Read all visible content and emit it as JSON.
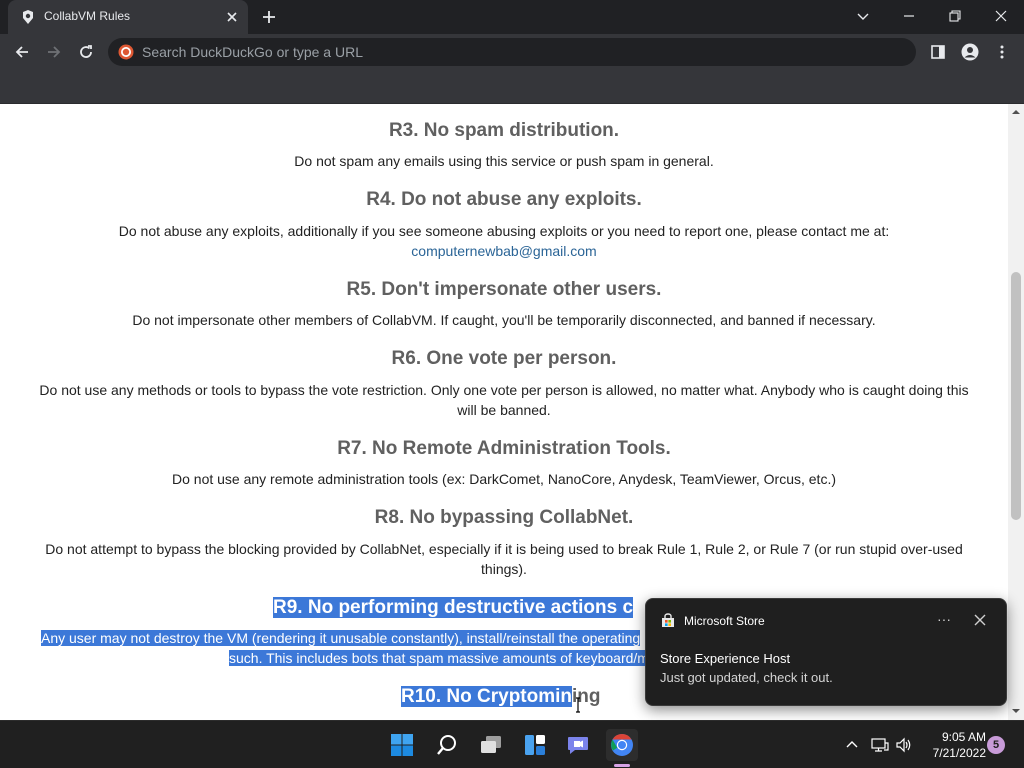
{
  "browser": {
    "tab_title": "CollabVM Rules",
    "omnibox_placeholder": "Search DuckDuckGo or type a URL"
  },
  "page": {
    "rules": [
      {
        "id": "r3",
        "title": "R3. No spam distribution.",
        "text": "Do not spam any emails using this service or push spam in general."
      },
      {
        "id": "r4",
        "title": "R4. Do not abuse any exploits.",
        "text": "Do not abuse any exploits, additionally if you see someone abusing exploits or you need to report one, please contact me at:",
        "email": "computernewbab@gmail.com"
      },
      {
        "id": "r5",
        "title": "R5. Don't impersonate other users.",
        "text": "Do not impersonate other members of CollabVM. If caught, you'll be temporarily disconnected, and banned if necessary."
      },
      {
        "id": "r6",
        "title": "R6. One vote per person.",
        "text_line1": "Do not use any methods or tools to bypass the vote restriction. Only one vote per person is allowed, no matter what. Anybody who is caught doing this",
        "text_line2": "will be banned."
      },
      {
        "id": "r7",
        "title": "R7. No Remote Administration Tools.",
        "text": "Do not use any remote administration tools (ex: DarkComet, NanoCore, Anydesk, TeamViewer, Orcus, etc.)"
      },
      {
        "id": "r8",
        "title": "R8. No bypassing CollabNet.",
        "text_line1": "Do not attempt to bypass the blocking provided by CollabNet, especially if it is being used to break Rule 1, Rule 2, or Rule 7 (or run stupid over-used",
        "text_line2": "things)."
      },
      {
        "id": "r9",
        "title": "R9. No performing destructive actions c",
        "text_line1": "Any user may not destroy the VM (rendering it unusable constantly), install/reinstall the operating",
        "text_line2": "such. This includes bots that spam massive amounts of keyboard/m"
      },
      {
        "id": "r10",
        "title_highlighted": "R10. No Cryptomin",
        "title_rest": "ing"
      }
    ]
  },
  "toast": {
    "app_name": "Microsoft Store",
    "more_label": "···",
    "title": "Store Experience Host",
    "body": "Just got updated, check it out."
  },
  "taskbar": {
    "time": "9:05 AM",
    "date": "7/21/2022",
    "notification_count": "5",
    "apps": [
      "start-icon",
      "search-icon",
      "task-view-icon",
      "widgets-icon",
      "teams-chat-icon",
      "chrome-icon"
    ]
  },
  "colors": {
    "selection": "#3c78d8",
    "rule_title": "#606060",
    "email_link": "#2a6496"
  }
}
